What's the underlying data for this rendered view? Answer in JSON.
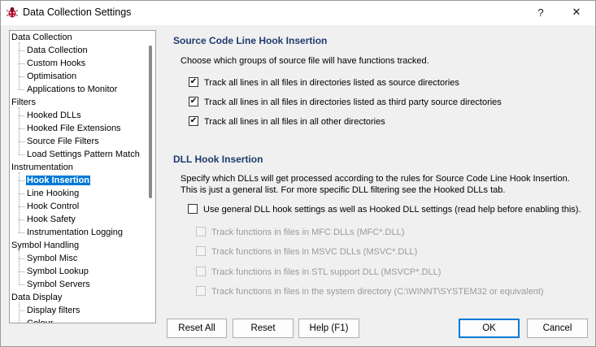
{
  "window": {
    "title": "Data Collection Settings",
    "help_glyph": "?",
    "close_glyph": "✕"
  },
  "tree": {
    "items": [
      {
        "label": "Data Collection",
        "level": 0
      },
      {
        "label": "Data Collection",
        "level": 1
      },
      {
        "label": "Custom Hooks",
        "level": 1
      },
      {
        "label": "Optimisation",
        "level": 1
      },
      {
        "label": "Applications to Monitor",
        "level": 1
      },
      {
        "label": "Filters",
        "level": 0
      },
      {
        "label": "Hooked DLLs",
        "level": 1
      },
      {
        "label": "Hooked File Extensions",
        "level": 1
      },
      {
        "label": "Source File Filters",
        "level": 1
      },
      {
        "label": "Load Settings Pattern Match",
        "level": 1
      },
      {
        "label": "Instrumentation",
        "level": 0
      },
      {
        "label": "Hook Insertion",
        "level": 1,
        "selected": true
      },
      {
        "label": "Line Hooking",
        "level": 1
      },
      {
        "label": "Hook Control",
        "level": 1
      },
      {
        "label": "Hook Safety",
        "level": 1
      },
      {
        "label": "Instrumentation Logging",
        "level": 1
      },
      {
        "label": "Symbol Handling",
        "level": 0
      },
      {
        "label": "Symbol Misc",
        "level": 1
      },
      {
        "label": "Symbol Lookup",
        "level": 1
      },
      {
        "label": "Symbol Servers",
        "level": 1
      },
      {
        "label": "Data Display",
        "level": 0
      },
      {
        "label": "Display filters",
        "level": 1
      },
      {
        "label": "Colour",
        "level": 1
      }
    ]
  },
  "source_section": {
    "title": "Source Code Line Hook Insertion",
    "description": "Choose which groups of source file will have functions tracked.",
    "options": [
      {
        "label": "Track all lines in all files in directories listed as source directories",
        "checked": true
      },
      {
        "label": "Track all lines in all files in directories listed as third party source directories",
        "checked": true
      },
      {
        "label": "Track all lines in all files in all other directories",
        "checked": true
      }
    ]
  },
  "dll_section": {
    "title": "DLL Hook Insertion",
    "description_line1": "Specify which DLLs will get processed according to the rules for Source Code Line Hook Insertion.",
    "description_line2": "This is just a general list. For more specific DLL filtering see the Hooked DLLs tab.",
    "general_option": {
      "label": "Use general DLL hook settings as well as Hooked DLL settings (read help before enabling this).",
      "checked": false
    },
    "sub_options": [
      {
        "label": "Track functions in files in MFC DLLs (MFC*.DLL)",
        "checked": false,
        "enabled": false
      },
      {
        "label": "Track functions in files in MSVC DLLs (MSVC*.DLL)",
        "checked": false,
        "enabled": false
      },
      {
        "label": "Track functions in files in STL support DLL (MSVCP*.DLL)",
        "checked": false,
        "enabled": false
      },
      {
        "label": "Track functions in files in the system directory (C:\\WINNT\\SYSTEM32 or equivalent)",
        "checked": false,
        "enabled": false
      }
    ]
  },
  "buttons": {
    "reset_all": "Reset All",
    "reset": "Reset",
    "help": "Help (F1)",
    "ok": "OK",
    "cancel": "Cancel"
  },
  "colors": {
    "section_title": "#1e3b6e",
    "selection": "#0078d7"
  }
}
